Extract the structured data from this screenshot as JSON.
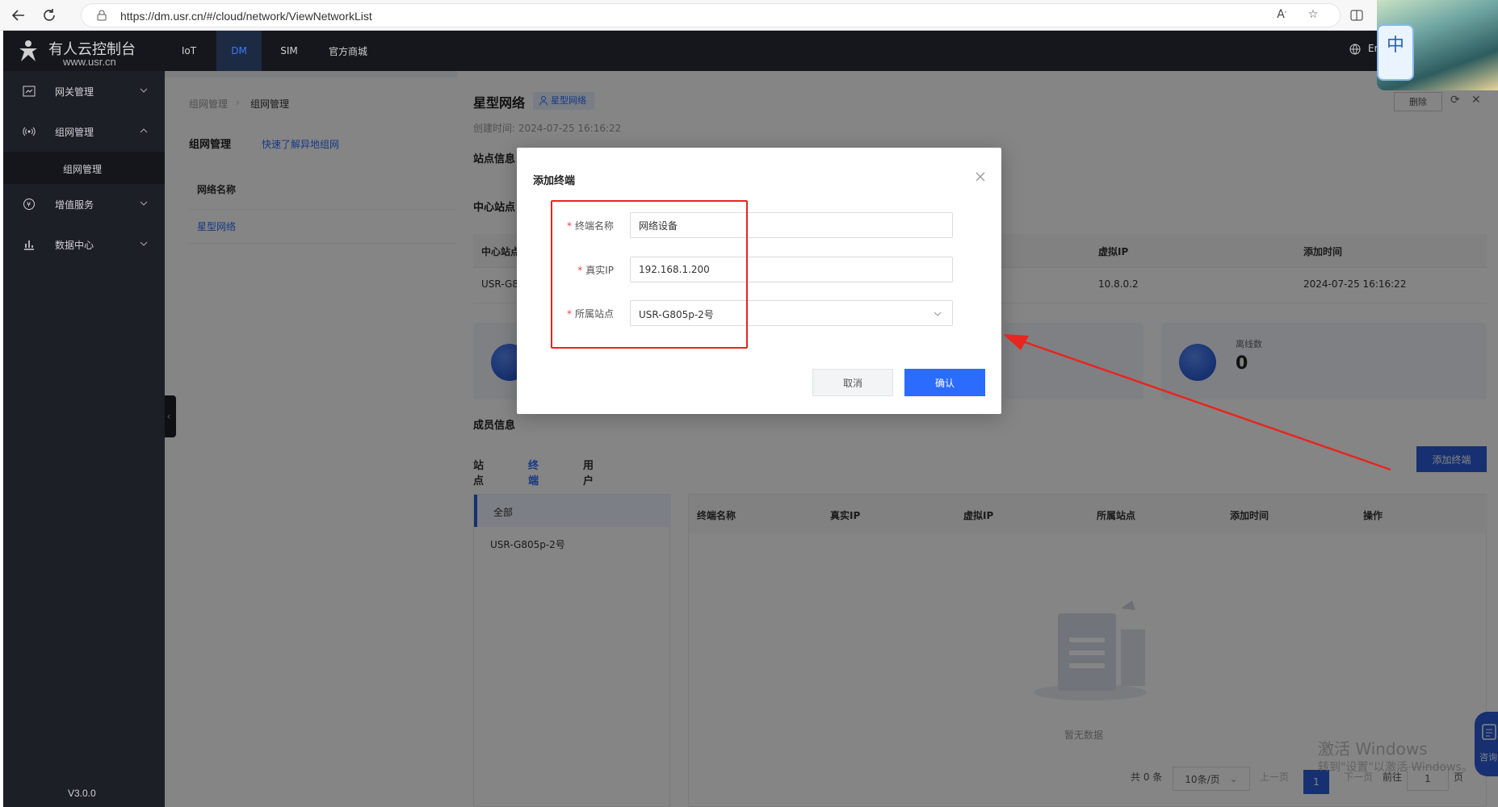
{
  "browser": {
    "url": "https://dm.usr.cn/#/cloud/network/ViewNetworkList"
  },
  "app": {
    "brand_name": "有人云控制台",
    "brand_site": "www.usr.cn",
    "top_nav": [
      "IoT",
      "DM",
      "SIM",
      "官方商城"
    ],
    "lang": "Er",
    "version": "V3.0.0",
    "avatar_badge": "中"
  },
  "sidebar": {
    "items": [
      {
        "label": "网关管理"
      },
      {
        "label": "组网管理"
      },
      {
        "label": "增值服务"
      },
      {
        "label": "数据中心"
      }
    ],
    "sub_item": "组网管理"
  },
  "left_panel": {
    "breadcrumb": [
      "组网管理",
      "组网管理"
    ],
    "title": "组网管理",
    "link": "快速了解异地组网",
    "col_header": "网络名称",
    "row": "星型网络"
  },
  "drawer": {
    "title": "星型网络",
    "tag": "星型网络",
    "created": "创建时间: 2024-07-25 16:16:22",
    "delete": "删除",
    "section_site": "站点信息",
    "section_center": "中心站点",
    "table_headers": [
      "中心站点",
      "虚拟IP",
      "添加时间"
    ],
    "table_row": [
      "USR-G8",
      "10.8.0.2",
      "2024-07-25 16:16:22"
    ],
    "stat_offline_label": "离线数",
    "stat_offline_value": "0",
    "section_member": "成员信息",
    "tabs": [
      "站点",
      "终端",
      "用户"
    ],
    "add_terminal": "添加终端",
    "member_list": [
      "全部",
      "USR-G805p-2号"
    ],
    "terminal_headers": [
      "终端名称",
      "真实IP",
      "虚拟IP",
      "所属站点",
      "添加时间",
      "操作"
    ],
    "empty": "暂无数据",
    "pager": {
      "total": "共 0 条",
      "per_page": "10条/页",
      "prev": "上一页",
      "current": "1",
      "next": "下一页",
      "goto": "前往",
      "goto_value": "1",
      "page_unit": "页"
    },
    "consult": "咨询"
  },
  "watermark": {
    "line1": "激活 Windows",
    "line2": "转到\"设置\"以激活 Windows。"
  },
  "modal": {
    "title": "添加终端",
    "fields": [
      {
        "label": "终端名称",
        "value": "网络设备"
      },
      {
        "label": "真实IP",
        "value": "192.168.1.200"
      },
      {
        "label": "所属站点",
        "value": "USR-G805p-2号"
      }
    ],
    "cancel": "取消",
    "confirm": "确认"
  },
  "colors": {
    "primary": "#2b6cff",
    "annotation_red": "#e8251f",
    "header_bg": "#15171c",
    "sidebar_bg": "#1d1f26"
  }
}
